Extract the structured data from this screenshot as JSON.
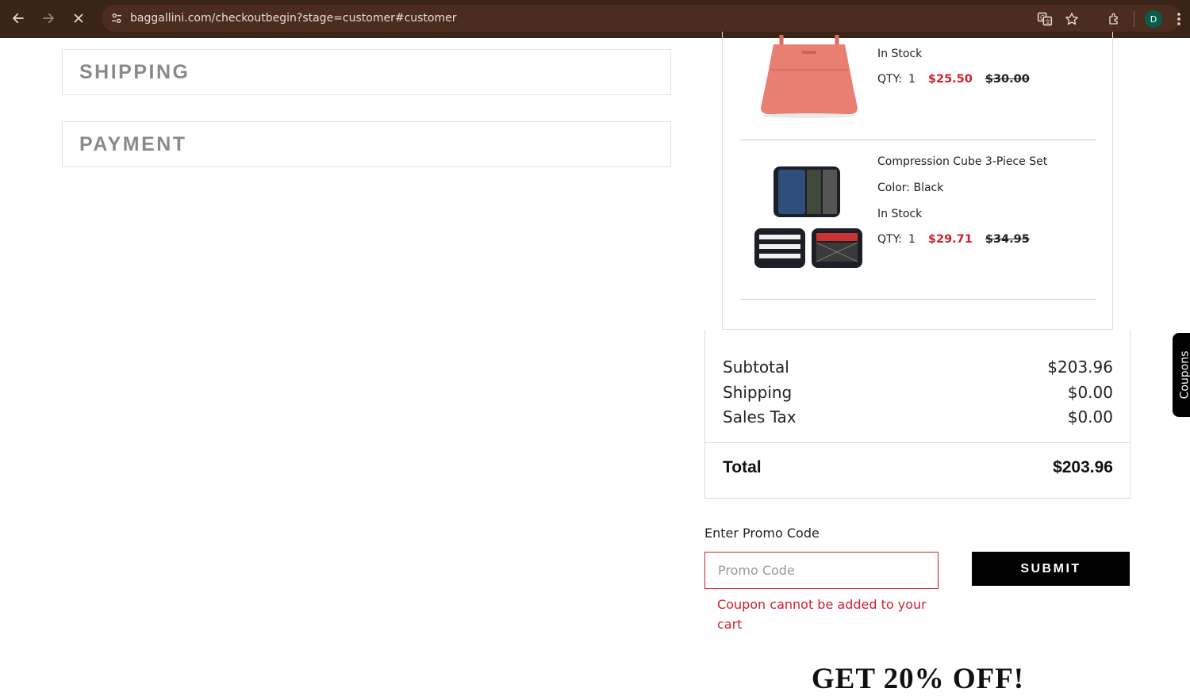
{
  "browser": {
    "url": "baggallini.com/checkoutbegin?stage=customer#customer",
    "profile_initial": "D"
  },
  "sections": {
    "shipping": "SHIPPING",
    "payment": "PAYMENT"
  },
  "items": [
    {
      "stock": "In Stock",
      "qty_label": "QTY:",
      "qty": "1",
      "sale_price": "$25.50",
      "original_price": "$30.00"
    },
    {
      "name": "Compression Cube 3-Piece Set",
      "color": "Color: Black",
      "stock": "In Stock",
      "qty_label": "QTY:",
      "qty": "1",
      "sale_price": "$29.71",
      "original_price": "$34.95"
    }
  ],
  "summary": {
    "subtotal_label": "Subtotal",
    "subtotal": "$203.96",
    "shipping_label": "Shipping",
    "shipping": "$0.00",
    "tax_label": "Sales Tax",
    "tax": "$0.00",
    "total_label": "Total",
    "total": "$203.96"
  },
  "promo": {
    "label": "Enter Promo Code",
    "placeholder": "Promo Code",
    "submit_label": "SUBMIT",
    "error": "Coupon cannot be added to your cart"
  },
  "banner": "GET 20% OFF!",
  "coupons_tab": "Coupons",
  "colors": {
    "accent_red": "#d0202e",
    "chrome_bg": "#3a2418",
    "tote_pink": "#e97e72"
  }
}
